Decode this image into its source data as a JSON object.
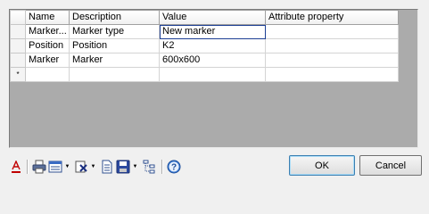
{
  "grid": {
    "columns": [
      "Name",
      "Description",
      "Value",
      "Attribute property"
    ],
    "rows": [
      {
        "name": "Marker...",
        "description": "Marker type",
        "value": "New marker",
        "attribute": ""
      },
      {
        "name": "Position",
        "description": "Position",
        "value": "K2",
        "attribute": ""
      },
      {
        "name": "Marker",
        "description": "Marker",
        "value": "600x600",
        "attribute": ""
      }
    ],
    "new_row_marker": "*"
  },
  "buttons": {
    "ok": "OK",
    "cancel": "Cancel"
  },
  "toolbar": {
    "icons": [
      "font-color-icon",
      "print-icon",
      "table-layout-icon",
      "delete-filter-icon",
      "document-icon",
      "save-icon",
      "tree-structure-icon",
      "help-icon"
    ]
  }
}
